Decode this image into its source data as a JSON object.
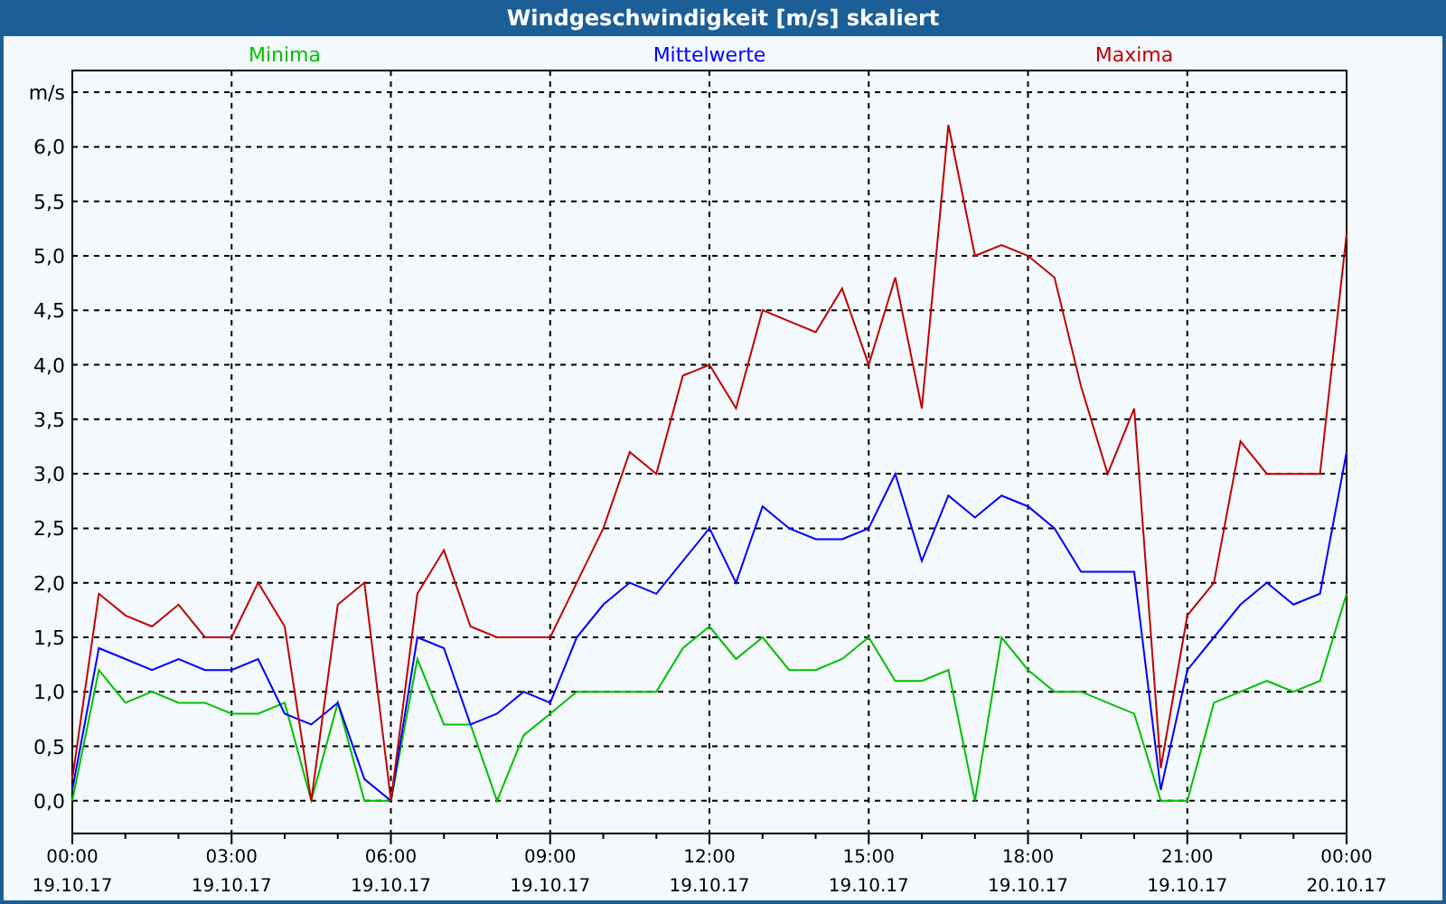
{
  "window": {
    "title": "Windgeschwindigkeit [m/s] skaliert"
  },
  "plot": {
    "chart_data": {
      "type": "line",
      "ylabel": "m/s",
      "ylim": [
        -0.3,
        6.7
      ],
      "grid": true,
      "categories": [
        "00:00\n19.10.17",
        null,
        null,
        null,
        null,
        null,
        "03:00\n19.10.17",
        null,
        null,
        null,
        null,
        null,
        "06:00\n19.10.17",
        null,
        null,
        null,
        null,
        null,
        "09:00\n19.10.17",
        null,
        null,
        null,
        null,
        null,
        "12:00\n19.10.17",
        null,
        null,
        null,
        null,
        null,
        "15:00\n19.10.17",
        null,
        null,
        null,
        null,
        null,
        "18:00\n19.10.17",
        null,
        null,
        null,
        null,
        null,
        "21:00\n19.10.17",
        null,
        null,
        null,
        null,
        null,
        "00:00\n20.10.17"
      ],
      "yticks": [
        {
          "value": 0,
          "label": "0,0"
        },
        {
          "value": 0.5,
          "label": "0,5"
        },
        {
          "value": 1,
          "label": "1,0"
        },
        {
          "value": 1.5,
          "label": "1,5"
        },
        {
          "value": 2,
          "label": "2,0"
        },
        {
          "value": 2.5,
          "label": "2,5"
        },
        {
          "value": 3,
          "label": "3,0"
        },
        {
          "value": 3.5,
          "label": "3,5"
        },
        {
          "value": 4,
          "label": "4,0"
        },
        {
          "value": 4.5,
          "label": "4,5"
        },
        {
          "value": 5,
          "label": "5,0"
        },
        {
          "value": 5.5,
          "label": "5,5"
        },
        {
          "value": 6,
          "label": "6,0"
        }
      ],
      "series": [
        {
          "name": "Minima",
          "color": "#00c000",
          "values": [
            0,
            1.2,
            0.9,
            1.0,
            0.9,
            0.9,
            0.8,
            0.8,
            0.9,
            0,
            0.9,
            0,
            0,
            1.3,
            0.7,
            0.7,
            0,
            0.6,
            0.8,
            1.0,
            1.0,
            1.0,
            1.0,
            1.4,
            1.6,
            1.3,
            1.5,
            1.2,
            1.2,
            1.3,
            1.5,
            1.1,
            1.1,
            1.2,
            0,
            1.5,
            1.2,
            1.0,
            1.0,
            0.9,
            0.8,
            0,
            0,
            0.9,
            1.0,
            1.1,
            1.0,
            1.1,
            1.9
          ]
        },
        {
          "name": "Mittelwerte",
          "color": "#0000ff",
          "values": [
            0.1,
            1.4,
            1.3,
            1.2,
            1.3,
            1.2,
            1.2,
            1.3,
            0.8,
            0.7,
            0.9,
            0.2,
            0,
            1.5,
            1.4,
            0.7,
            0.8,
            1.0,
            0.9,
            1.5,
            1.8,
            2.0,
            1.9,
            2.2,
            2.5,
            2.0,
            2.7,
            2.5,
            2.4,
            2.4,
            2.5,
            3.0,
            2.2,
            2.8,
            2.6,
            2.8,
            2.7,
            2.5,
            2.1,
            2.1,
            2.1,
            0.1,
            1.2,
            1.5,
            1.8,
            2.0,
            1.8,
            1.9,
            3.2
          ]
        },
        {
          "name": "Maxima",
          "color": "#c00000",
          "values": [
            0.2,
            1.9,
            1.7,
            1.6,
            1.8,
            1.5,
            1.5,
            2.0,
            1.6,
            0,
            1.8,
            2.0,
            0,
            1.9,
            2.3,
            1.6,
            1.5,
            1.5,
            1.5,
            2.0,
            2.5,
            3.2,
            3.0,
            3.9,
            4.0,
            3.6,
            4.5,
            4.4,
            4.3,
            4.7,
            4.0,
            4.8,
            3.6,
            6.2,
            5.0,
            5.1,
            5.0,
            4.8,
            3.8,
            3.0,
            3.6,
            0.3,
            1.7,
            2.0,
            3.3,
            3.0,
            3.0,
            3.0,
            5.2
          ]
        }
      ]
    }
  }
}
